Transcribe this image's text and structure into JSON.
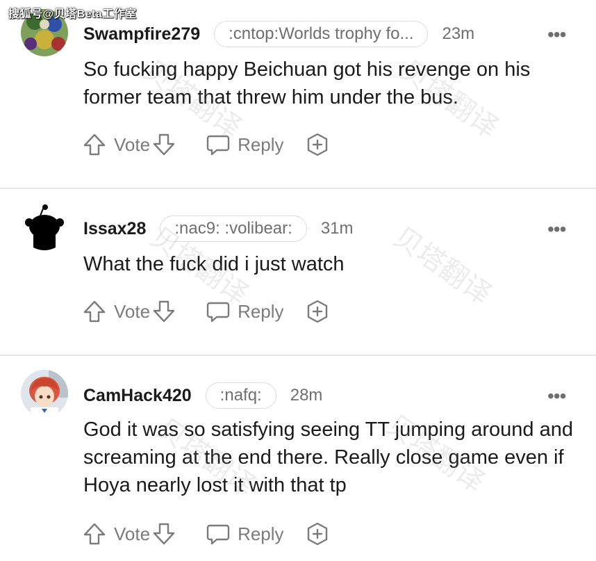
{
  "source_watermark": "搜狐号@贝塔Beta工作室",
  "overlay_watermark": "贝塔翻译",
  "comments": [
    {
      "username": "Swampfire279",
      "flair": ":cntop:Worlds trophy fo...",
      "time": "23m",
      "more": "•••",
      "body": "So fucking happy Beichuan got his revenge on his former team that threw him under the bus.",
      "vote_label": "Vote",
      "reply_label": "Reply",
      "avatar_icon": "user-avatar-icon"
    },
    {
      "username": "Issax28",
      "flair": ":nac9: :volibear:",
      "time": "31m",
      "more": "•••",
      "body": "What the fuck did i just watch",
      "vote_label": "Vote",
      "reply_label": "Reply",
      "avatar_icon": "default-snoo-avatar-icon"
    },
    {
      "username": "CamHack420",
      "flair": ":nafq:",
      "time": "28m",
      "more": "•••",
      "body": "God it was so satisfying seeing TT jumping around and screaming at the end there. Really close game even if Hoya nearly lost it with that tp",
      "vote_label": "Vote",
      "reply_label": "Reply",
      "avatar_icon": "anime-avatar-icon"
    }
  ],
  "colors": {
    "text": "#1a1a1b",
    "muted": "#6f6f6f",
    "action": "#7b7b7b",
    "divider": "#e6e6e6",
    "flair_border": "#dcdcdc"
  }
}
